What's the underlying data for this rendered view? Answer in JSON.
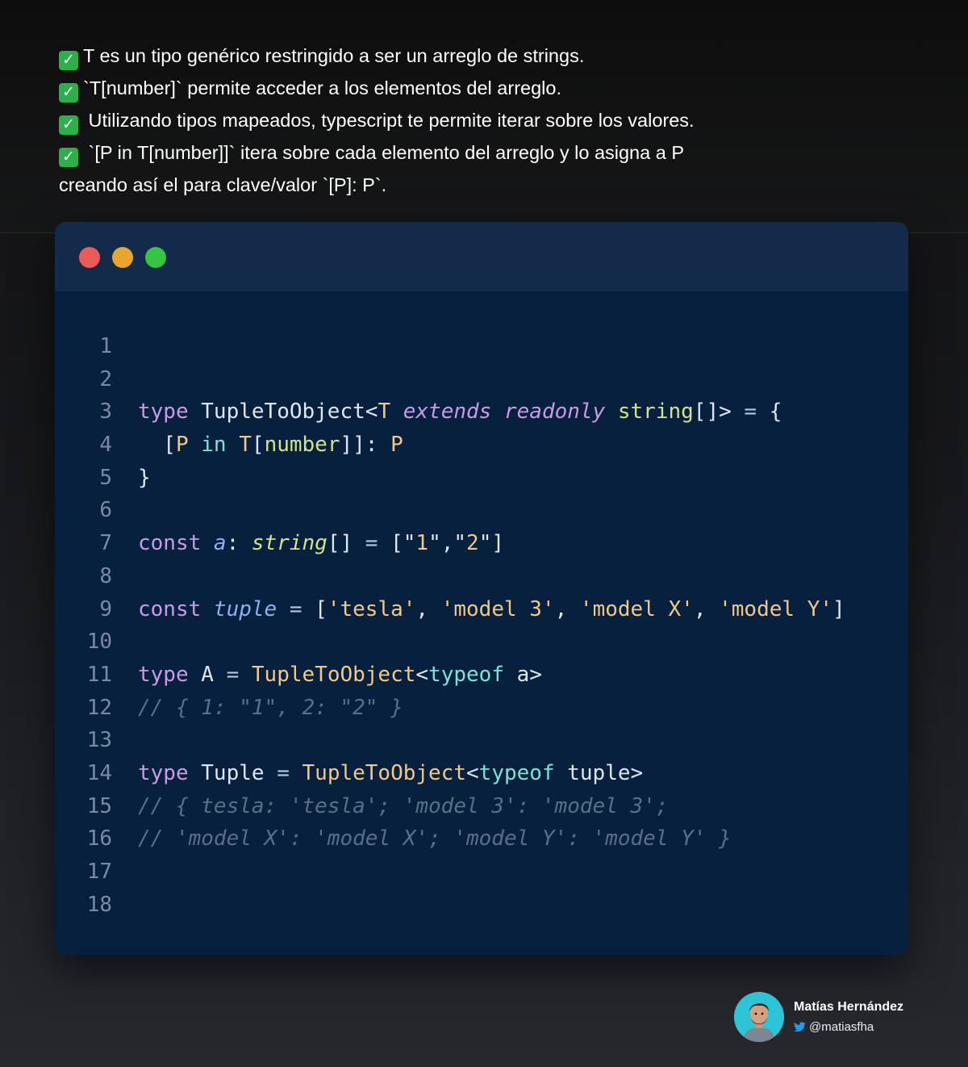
{
  "description": {
    "lines": [
      {
        "check": true,
        "text": "T es un tipo genérico restringido a ser un arreglo de strings."
      },
      {
        "check": true,
        "text": "`T[number]` permite acceder a los elementos del arreglo."
      },
      {
        "check": true,
        "text": " Utilizando tipos mapeados, typescript te permite iterar sobre los valores."
      },
      {
        "check": true,
        "text": " `[P in T[number]]` itera sobre cada elemento del arreglo y lo asigna a P"
      },
      {
        "check": false,
        "text": "creando así el para clave/valor `[P]: P`."
      }
    ],
    "check_icon": "check-mark-button"
  },
  "window": {
    "controls": [
      "close",
      "minimize",
      "maximize"
    ],
    "colors": {
      "close": "#ec5b56",
      "minimize": "#e8a530",
      "maximize": "#36c443",
      "background": "#06203e"
    }
  },
  "code": {
    "lines": [
      {
        "n": "1",
        "tokens": []
      },
      {
        "n": "2",
        "tokens": []
      },
      {
        "n": "3",
        "tokens": [
          {
            "t": "type",
            "c": "kw"
          },
          {
            "t": " TupleToObject<",
            "c": "punct"
          },
          {
            "t": "T",
            "c": "type"
          },
          {
            "t": " extends",
            "c": "kwi"
          },
          {
            "t": " readonly",
            "c": "kwi"
          },
          {
            "t": " string",
            "c": "builtin"
          },
          {
            "t": "[]> ",
            "c": "punct"
          },
          {
            "t": "=",
            "c": "op"
          },
          {
            "t": " {",
            "c": "punct"
          }
        ]
      },
      {
        "n": "4",
        "tokens": [
          {
            "t": "  [",
            "c": "punct"
          },
          {
            "t": "P",
            "c": "type"
          },
          {
            "t": " in",
            "c": "typeof"
          },
          {
            "t": " T",
            "c": "type"
          },
          {
            "t": "[",
            "c": "punct"
          },
          {
            "t": "number",
            "c": "builtin"
          },
          {
            "t": "]]: ",
            "c": "punct"
          },
          {
            "t": "P",
            "c": "type"
          }
        ]
      },
      {
        "n": "5",
        "tokens": [
          {
            "t": "}",
            "c": "punct"
          }
        ]
      },
      {
        "n": "6",
        "tokens": []
      },
      {
        "n": "7",
        "tokens": [
          {
            "t": "const",
            "c": "kw"
          },
          {
            "t": " a",
            "c": "var"
          },
          {
            "t": ": ",
            "c": "punct"
          },
          {
            "t": "string",
            "c": "vart"
          },
          {
            "t": "[] ",
            "c": "punct"
          },
          {
            "t": "=",
            "c": "op"
          },
          {
            "t": " [\"",
            "c": "punct"
          },
          {
            "t": "1",
            "c": "str"
          },
          {
            "t": "\",\"",
            "c": "punct"
          },
          {
            "t": "2",
            "c": "str"
          },
          {
            "t": "\"]",
            "c": "punct"
          }
        ]
      },
      {
        "n": "8",
        "tokens": []
      },
      {
        "n": "9",
        "tokens": [
          {
            "t": "const",
            "c": "kw"
          },
          {
            "t": " tuple",
            "c": "var"
          },
          {
            "t": " =",
            "c": "op"
          },
          {
            "t": " [",
            "c": "punct"
          },
          {
            "t": "'tesla'",
            "c": "str"
          },
          {
            "t": ", ",
            "c": "punct"
          },
          {
            "t": "'model 3'",
            "c": "str"
          },
          {
            "t": ", ",
            "c": "punct"
          },
          {
            "t": "'model X'",
            "c": "str"
          },
          {
            "t": ", ",
            "c": "punct"
          },
          {
            "t": "'model Y'",
            "c": "str"
          },
          {
            "t": "]",
            "c": "punct"
          }
        ]
      },
      {
        "n": "10",
        "tokens": []
      },
      {
        "n": "11",
        "tokens": [
          {
            "t": "type",
            "c": "kw"
          },
          {
            "t": " A ",
            "c": "punct"
          },
          {
            "t": "=",
            "c": "op"
          },
          {
            "t": " TupleToObject",
            "c": "type"
          },
          {
            "t": "<",
            "c": "punct"
          },
          {
            "t": "typeof",
            "c": "typeof"
          },
          {
            "t": " a>",
            "c": "punct"
          }
        ]
      },
      {
        "n": "12",
        "tokens": [
          {
            "t": "// { 1: \"1\", 2: \"2\" }",
            "c": "comment"
          }
        ]
      },
      {
        "n": "13",
        "tokens": []
      },
      {
        "n": "14",
        "tokens": [
          {
            "t": "type",
            "c": "kw"
          },
          {
            "t": " Tuple ",
            "c": "punct"
          },
          {
            "t": "=",
            "c": "op"
          },
          {
            "t": " TupleToObject",
            "c": "type"
          },
          {
            "t": "<",
            "c": "punct"
          },
          {
            "t": "typeof",
            "c": "typeof"
          },
          {
            "t": " tuple>",
            "c": "punct"
          }
        ]
      },
      {
        "n": "15",
        "tokens": [
          {
            "t": "// { tesla: 'tesla'; 'model 3': 'model 3';",
            "c": "comment"
          }
        ]
      },
      {
        "n": "16",
        "tokens": [
          {
            "t": "// 'model X': 'model X'; 'model Y': 'model Y' }",
            "c": "comment"
          }
        ]
      },
      {
        "n": "17",
        "tokens": []
      },
      {
        "n": "18",
        "tokens": []
      }
    ]
  },
  "author": {
    "name": "Matías Hernández",
    "handle": "@matiasfha",
    "handle_icon": "twitter-bird-icon",
    "avatar_bg": "#2ec4d8"
  }
}
